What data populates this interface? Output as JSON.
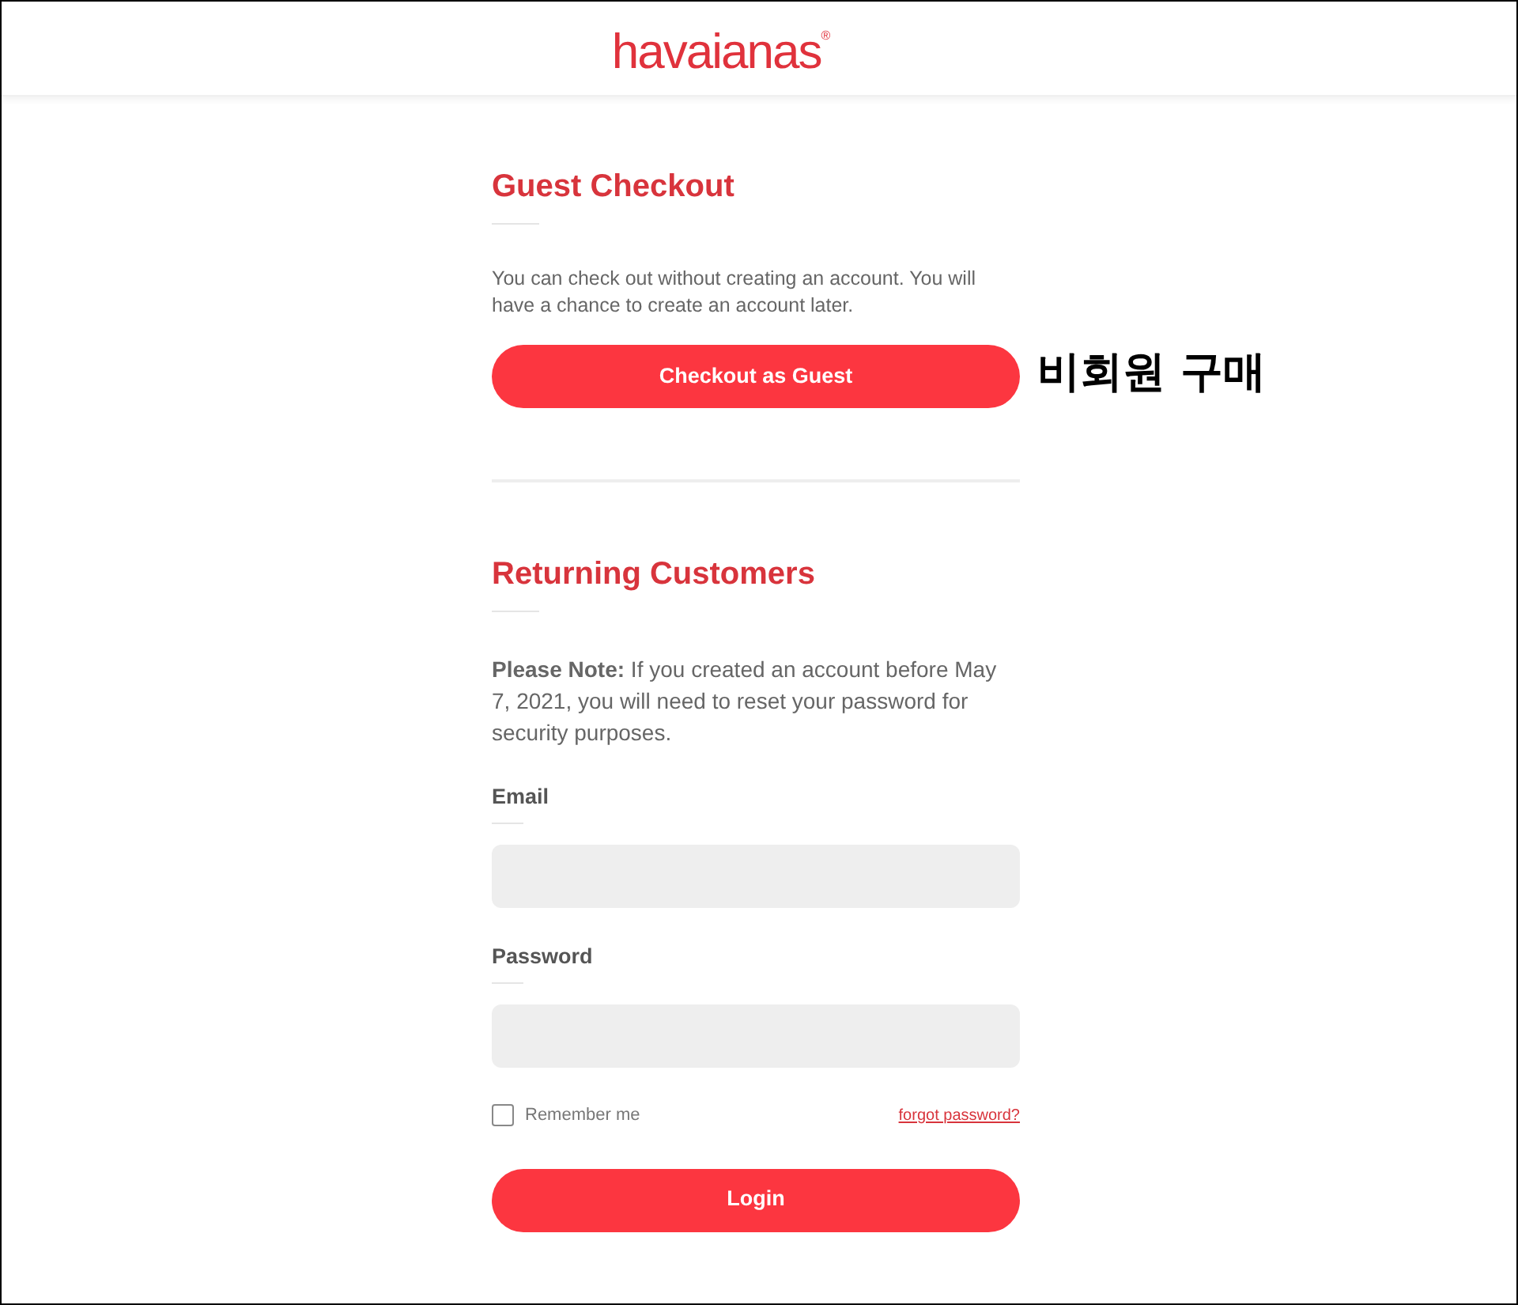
{
  "header": {
    "logo": "havaianas",
    "logo_mark": "®"
  },
  "guest_checkout": {
    "heading": "Guest Checkout",
    "text": "You can check out without creating an account. You will have a chance to create an account later.",
    "button": "Checkout as Guest",
    "annotation": "비회원 구매"
  },
  "returning_customers": {
    "heading": "Returning Customers",
    "note": "**Please Note:** If you created an account before May 7, 2021, you will need to reset your password for security purposes.",
    "fields": [
      {
        "label": "Email"
      },
      {
        "label": "Password"
      }
    ],
    "remember_me": {
      "label": "Remember me",
      "checked": false
    },
    "forgot_link": "forgot password?",
    "button": "Login"
  }
}
